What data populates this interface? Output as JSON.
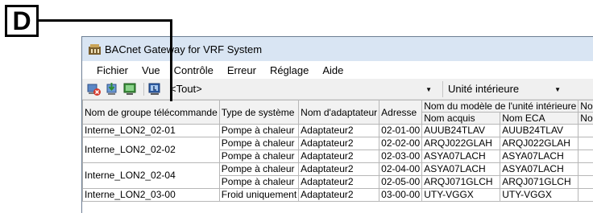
{
  "callout": {
    "label": "D"
  },
  "window": {
    "title": "BACnet Gateway for VRF System"
  },
  "menu": [
    "Fichier",
    "Vue",
    "Contrôle",
    "Erreur",
    "Réglage",
    "Aide"
  ],
  "toolbar": {
    "icons": [
      "delete-device-icon",
      "download-icon",
      "monitor-icon",
      "gateway-settings-icon"
    ],
    "filter_value": "<Tout>",
    "unit_value": "Unité intérieure"
  },
  "table": {
    "headers": {
      "group_name": "Nom de groupe télécommande",
      "system_type": "Type de système",
      "adapter_name": "Nom d'adaptateur",
      "address": "Adresse",
      "model_name": "Nom du modèle de l'unité intérieure",
      "acquired_name": "Nom acquis",
      "eca_name": "Nom ECA",
      "extra": "Nom",
      "extra_sub": "Nom"
    },
    "groups": [
      "Interne_LON2_02-01",
      "Interne_LON2_02-02",
      "Interne_LON2_02-04",
      "Interne_LON2_03-00"
    ],
    "rows": [
      {
        "system": "Pompe à chaleur",
        "adapter": "Adaptateur2",
        "address": "02-01-00",
        "acquired": "AUUB24TLAV",
        "eca": "AUUB24TLAV"
      },
      {
        "system": "Pompe à chaleur",
        "adapter": "Adaptateur2",
        "address": "02-02-00",
        "acquired": "ARQJ022GLAH",
        "eca": "ARQJ022GLAH"
      },
      {
        "system": "Pompe à chaleur",
        "adapter": "Adaptateur2",
        "address": "02-03-00",
        "acquired": "ASYA07LACH",
        "eca": "ASYA07LACH"
      },
      {
        "system": "Pompe à chaleur",
        "adapter": "Adaptateur2",
        "address": "02-04-00",
        "acquired": "ASYA07LACH",
        "eca": "ASYA07LACH"
      },
      {
        "system": "Pompe à chaleur",
        "adapter": "Adaptateur2",
        "address": "02-05-00",
        "acquired": "ARQJ071GLCH",
        "eca": "ARQJ071GLCH"
      },
      {
        "system": "Froid uniquement",
        "adapter": "Adaptateur2",
        "address": "03-00-00",
        "acquired": "UTY-VGGX",
        "eca": "UTY-VGGX"
      }
    ]
  }
}
